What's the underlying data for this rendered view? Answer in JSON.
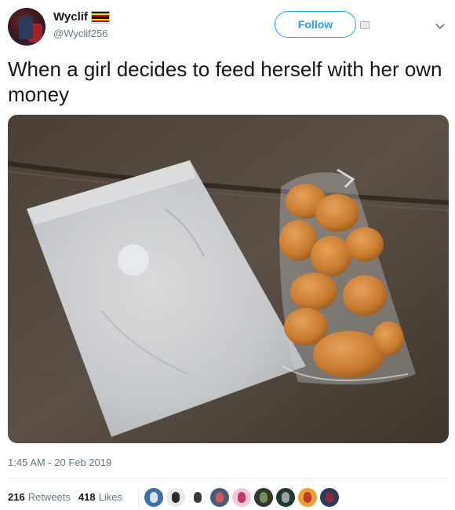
{
  "user": {
    "display_name": "Wyclif",
    "handle": "@Wyclif256",
    "flag_colors": [
      "#000000",
      "#fcdc04",
      "#d90000",
      "#000000",
      "#fcdc04",
      "#d90000"
    ]
  },
  "actions": {
    "follow_label": "Follow",
    "follow_color": "#1da1f2"
  },
  "tweet": {
    "text": "When a girl decides to feed herself with her own money",
    "timestamp": "1:45 AM - 20 Feb 2019"
  },
  "stats": {
    "retweets_count": "216",
    "retweets_label": "Retweets",
    "likes_count": "418",
    "likes_label": "Likes"
  },
  "likers": [
    {
      "bg": "#3c6fb0",
      "fg": "#d9e2ee"
    },
    {
      "bg": "#e8e8e8",
      "fg": "#2c2c2c"
    },
    {
      "bg": "#ffffff",
      "fg": "#3a3a3a"
    },
    {
      "bg": "#4a5a7a",
      "fg": "#c85a5a"
    },
    {
      "bg": "#f3c6d8",
      "fg": "#c4366e"
    },
    {
      "bg": "#2c3a2a",
      "fg": "#7a8c5c"
    },
    {
      "bg": "#1e3a2e",
      "fg": "#a0a0a0"
    },
    {
      "bg": "#f0a030",
      "fg": "#c0392b"
    },
    {
      "bg": "#2d3b5c",
      "fg": "#8a2b3b"
    }
  ],
  "icons": {
    "caret": "chevron-down-icon",
    "small": "media-icon"
  }
}
